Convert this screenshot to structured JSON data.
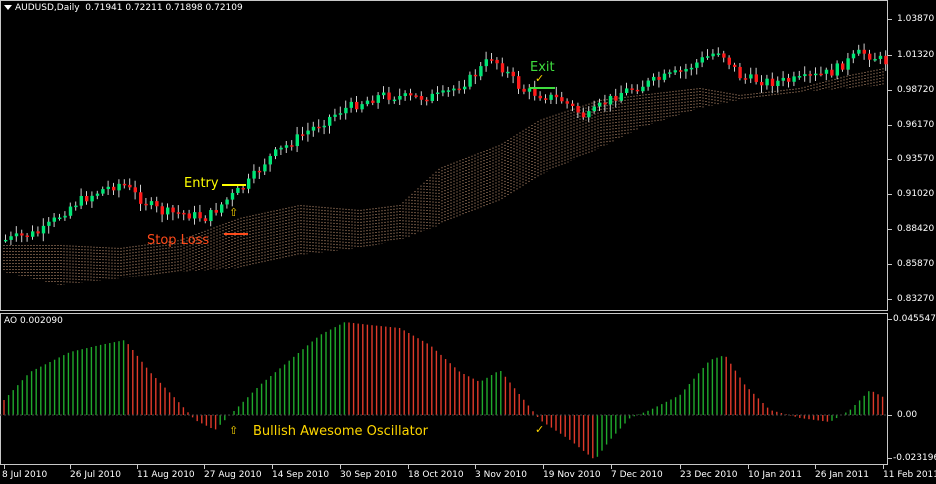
{
  "main": {
    "symbol_label": "AUDUSD,Daily",
    "ohlc_label": "0.71941 0.72211 0.71898 0.72109",
    "price_axis": [
      "1.03870",
      "1.01320",
      "0.98720",
      "0.96170",
      "0.93570",
      "0.91020",
      "0.88420",
      "0.85870",
      "0.83270"
    ],
    "annotations": {
      "entry": "Entry",
      "stop_loss": "Stop Loss",
      "exit": "Exit",
      "entry_arrow": "⇧",
      "exit_check": "✓"
    }
  },
  "ao": {
    "label": "AO 0.002090",
    "axis": [
      "0.045547",
      "0.00",
      "-0.023196"
    ],
    "annotation": "Bullish Awesome Oscillator",
    "arrow": "⇧",
    "check": "✓"
  },
  "dates": [
    "8 Jul 2010",
    "26 Jul 2010",
    "11 Aug 2010",
    "27 Aug 2010",
    "14 Sep 2010",
    "30 Sep 2010",
    "18 Oct 2010",
    "3 Nov 2010",
    "19 Nov 2010",
    "7 Dec 2010",
    "23 Dec 2010",
    "10 Jan 2011",
    "26 Jan 2011",
    "11 Feb 2011"
  ],
  "colors": {
    "bull_candle": "#00e676",
    "bear_candle": "#ff1a1a",
    "ao_up": "#1faa2c",
    "ao_down": "#e03a2a",
    "cloud": "#f0b890",
    "entry": "#ffff00",
    "stop_loss": "#ff4a1a",
    "exit": "#3fdc3f",
    "annotation_yellow": "#ffd700"
  }
}
